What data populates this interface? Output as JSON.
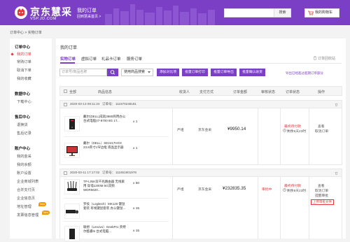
{
  "header": {
    "logo_text": "京东慧采",
    "logo_url": "VSP.JD.COM",
    "page_title": "我的订单",
    "back_link": "回到慧采首页 >",
    "search_placeholder": "",
    "search_button": "搜索",
    "cart_label": "我的购物车",
    "brand_color": "#7a3fc4"
  },
  "breadcrumb": "订单中心 > 实物订单",
  "sidebar": {
    "groups": [
      {
        "title": "订单中心",
        "items": [
          "我的订单",
          "常购订单",
          "取消下单",
          "我的收藏"
        ]
      },
      {
        "title": "数据中心",
        "items": [
          "下载中心"
        ]
      },
      {
        "title": "售后中心",
        "items": [
          "退换货",
          "售后记录"
        ]
      },
      {
        "title": "账户中心",
        "items": [
          "我的金采",
          "我的余额",
          "账户设置",
          "企业商城列表",
          "合并支付页",
          "企业信息页",
          "地址管理",
          "发票信息管理"
        ]
      }
    ],
    "active_item": "我的订单",
    "new_badge": "New"
  },
  "main": {
    "title": "我的订单",
    "tabs": [
      "实物订单",
      "虚拟订单",
      "礼品卡订单",
      "服务订单"
    ],
    "recycle_label": "订单回收站",
    "search_placeholder": "订单号/商品名称",
    "search_mode": "使用商品搜索",
    "buttons": [
      "添加对比项",
      "批量订单打印",
      "批量订单导出",
      "批量确认收货"
    ],
    "export_link": "导出已经超过超期订单部分",
    "columns": [
      "全部",
      "商品信息",
      "收货人",
      "支付方式",
      "订单金额",
      "审核状态",
      "订单状态",
      "操作"
    ]
  },
  "orders": [
    {
      "date": "2020-03-13 08:11:24",
      "order_label": "订单号：",
      "order_no": "111670248181",
      "consignee": "严组",
      "payment": "京东金采",
      "amount": "¥9950.14",
      "order_status": "最终待付款",
      "countdown": "剩余6天23时",
      "actions": [
        "查看",
        "取消订单"
      ],
      "items": [
        {
          "name": "戴尔(DELL)成就3980商用办公台式电脑(I7-8700 8G 1T...",
          "qty": "x 1"
        },
        {
          "name": "戴尔（DELL）SE2417HGX 23.8英寸1窄边框 液晶显示器",
          "qty": "x 1"
        }
      ]
    },
    {
      "date": "2020-03-11 17:17:02",
      "order_label": "订单号：",
      "order_no": "111651901978",
      "consignee": "严组",
      "payment": "京东金采",
      "amount": "¥232835.35",
      "audit_status": "审批中",
      "order_status": "最终待付款",
      "countdown": "剩余8天23时",
      "actions": [
        "查看",
        "取消订单",
        "提醒审批"
      ],
      "upload_button": "上传审批文件",
      "items": [
        {
          "name": "TP-LINK双千兆路由器 无线家用 穿墙1200M 5G双频WDR5620...",
          "qty": "x 50"
        },
        {
          "name": "罗技（Logitech）MK120 键鼠套装 有线键鼠套装 办公键鼠...",
          "qty": "x 15"
        },
        {
          "name": "联想（Lenovo）GeekPro 英特尔酷睿i5 台式电脑...",
          "qty": "x 15"
        }
      ]
    }
  ]
}
